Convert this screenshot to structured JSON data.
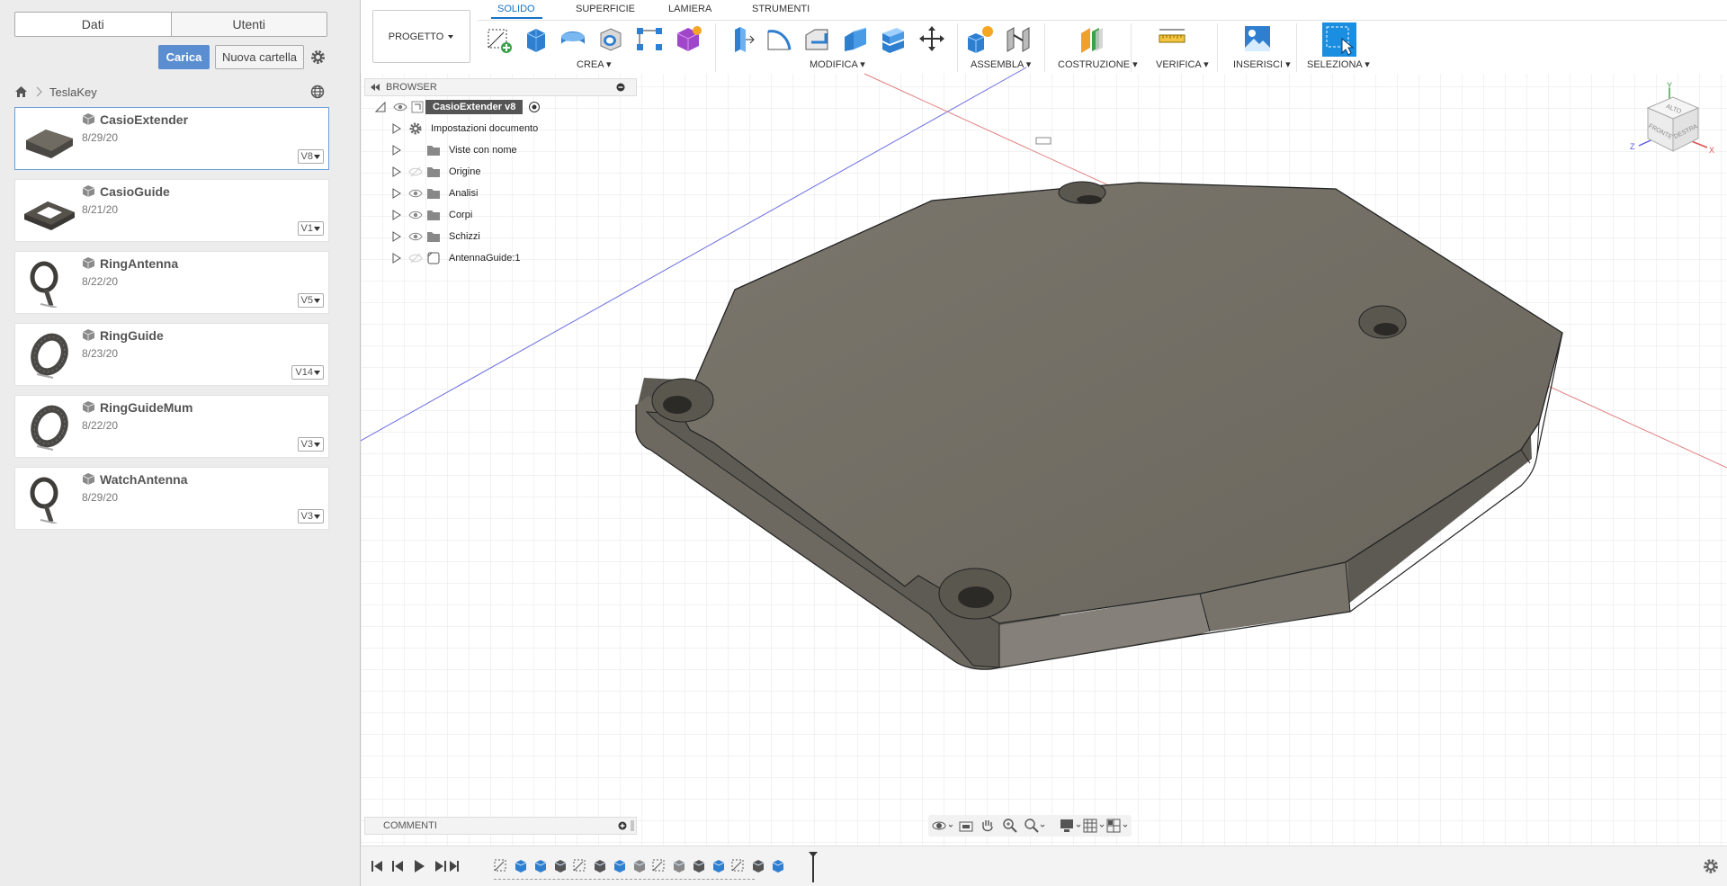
{
  "data_panel": {
    "tabs": [
      {
        "label": "Dati",
        "active": true
      },
      {
        "label": "Utenti",
        "active": false
      }
    ],
    "upload_label": "Carica",
    "new_folder_label": "Nuova cartella",
    "breadcrumb": "TeslaKey",
    "files": [
      {
        "name": "CasioExtender",
        "date": "8/29/20",
        "version": "V8",
        "selected": true,
        "shape": "extender"
      },
      {
        "name": "CasioGuide",
        "date": "8/21/20",
        "version": "V1",
        "selected": false,
        "shape": "guide"
      },
      {
        "name": "RingAntenna",
        "date": "8/22/20",
        "version": "V5",
        "selected": false,
        "shape": "ring-antenna"
      },
      {
        "name": "RingGuide",
        "date": "8/23/20",
        "version": "V14",
        "selected": false,
        "shape": "ring-guide"
      },
      {
        "name": "RingGuideMum",
        "date": "8/22/20",
        "version": "V3",
        "selected": false,
        "shape": "ring-guide"
      },
      {
        "name": "WatchAntenna",
        "date": "8/29/20",
        "version": "V3",
        "selected": false,
        "shape": "ring-antenna"
      }
    ]
  },
  "toolbar": {
    "project_label": "PROGETTO",
    "tabs": [
      {
        "label": "SOLIDO",
        "active": true
      },
      {
        "label": "SUPERFICIE",
        "active": false
      },
      {
        "label": "LAMIERA",
        "active": false
      },
      {
        "label": "STRUMENTI",
        "active": false
      }
    ],
    "groups": [
      "CREA",
      "MODIFICA",
      "ASSEMBLA",
      "COSTRUZIONE",
      "VERIFICA",
      "INSERISCI",
      "SELEZIONA"
    ]
  },
  "browser": {
    "title": "BROWSER",
    "root": "CasioExtender v8",
    "nodes": [
      {
        "label": "Impostazioni documento",
        "icon": "gear-icon",
        "eye": "none"
      },
      {
        "label": "Viste con nome",
        "icon": "folder-icon",
        "eye": "none"
      },
      {
        "label": "Origine",
        "icon": "folder-icon",
        "eye": "hidden"
      },
      {
        "label": "Analisi",
        "icon": "folder-icon",
        "eye": "visible"
      },
      {
        "label": "Corpi",
        "icon": "folder-icon",
        "eye": "visible"
      },
      {
        "label": "Schizzi",
        "icon": "folder-icon",
        "eye": "visible"
      },
      {
        "label": "AntennaGuide:1",
        "icon": "component-icon",
        "eye": "hidden"
      }
    ]
  },
  "viewcube": {
    "top": "ALTO",
    "front": "FRONTE",
    "right": "DESTRA",
    "axes": [
      "X",
      "Y",
      "Z"
    ]
  },
  "comments_label": "COMMENTI",
  "colors": {
    "accent": "#1473c6",
    "upload_button": "#5b8ed0",
    "part": "#6f6b62",
    "part_top": "#807b71",
    "x_axis": "#e06060",
    "y_axis": "#6060e0",
    "grid": "#e3e3e3"
  }
}
